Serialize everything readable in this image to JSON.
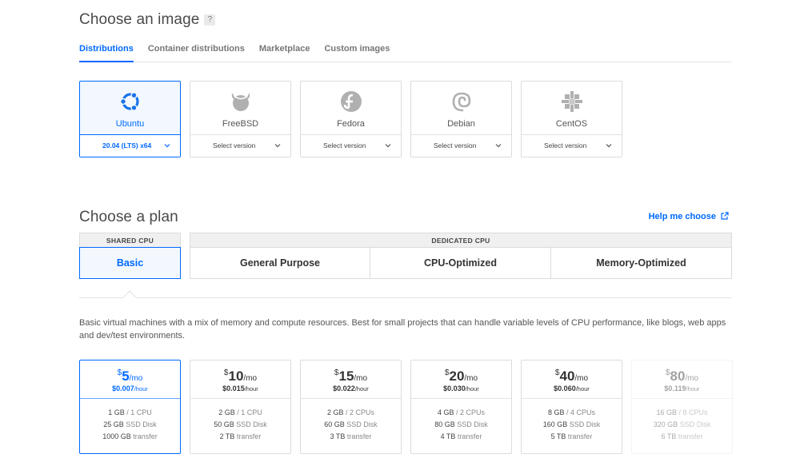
{
  "image_section": {
    "title": "Choose an image",
    "help": "?",
    "tabs": [
      {
        "label": "Distributions",
        "active": true
      },
      {
        "label": "Container distributions",
        "active": false
      },
      {
        "label": "Marketplace",
        "active": false
      },
      {
        "label": "Custom images",
        "active": false
      }
    ],
    "distros": [
      {
        "name": "Ubuntu",
        "version": "20.04 (LTS) x64",
        "icon": "ubuntu-icon",
        "selected": true
      },
      {
        "name": "FreeBSD",
        "version": "Select version",
        "icon": "freebsd-icon",
        "selected": false
      },
      {
        "name": "Fedora",
        "version": "Select version",
        "icon": "fedora-icon",
        "selected": false
      },
      {
        "name": "Debian",
        "version": "Select version",
        "icon": "debian-icon",
        "selected": false
      },
      {
        "name": "CentOS",
        "version": "Select version",
        "icon": "centos-icon",
        "selected": false
      }
    ]
  },
  "plan_section": {
    "title": "Choose a plan",
    "help_link": "Help me choose",
    "shared_label": "SHARED CPU",
    "dedicated_label": "DEDICATED CPU",
    "plans": {
      "basic": "Basic",
      "general": "General Purpose",
      "cpu": "CPU-Optimized",
      "memory": "Memory-Optimized"
    },
    "description": "Basic virtual machines with a mix of memory and compute resources. Best for small projects that can handle variable levels of CPU performance, like blogs, web apps and dev/test environments.",
    "prices": [
      {
        "dollar": "$",
        "price": "5",
        "per": "/mo",
        "hourly": "$0.007",
        "hour_unit": "/hour",
        "mem_amt": "1 GB",
        "cpu": "/ 1 CPU",
        "disk_amt": "25 GB",
        "disk_unit": "SSD Disk",
        "transfer_amt": "1000 GB",
        "transfer_unit": "transfer",
        "selected": true,
        "disabled": false
      },
      {
        "dollar": "$",
        "price": "10",
        "per": "/mo",
        "hourly": "$0.015",
        "hour_unit": "/hour",
        "mem_amt": "2 GB",
        "cpu": "/ 1 CPU",
        "disk_amt": "50 GB",
        "disk_unit": "SSD Disk",
        "transfer_amt": "2 TB",
        "transfer_unit": "transfer",
        "selected": false,
        "disabled": false
      },
      {
        "dollar": "$",
        "price": "15",
        "per": "/mo",
        "hourly": "$0.022",
        "hour_unit": "/hour",
        "mem_amt": "2 GB",
        "cpu": "/ 2 CPUs",
        "disk_amt": "60 GB",
        "disk_unit": "SSD Disk",
        "transfer_amt": "3 TB",
        "transfer_unit": "transfer",
        "selected": false,
        "disabled": false
      },
      {
        "dollar": "$",
        "price": "20",
        "per": "/mo",
        "hourly": "$0.030",
        "hour_unit": "/hour",
        "mem_amt": "4 GB",
        "cpu": "/ 2 CPUs",
        "disk_amt": "80 GB",
        "disk_unit": "SSD Disk",
        "transfer_amt": "4 TB",
        "transfer_unit": "transfer",
        "selected": false,
        "disabled": false
      },
      {
        "dollar": "$",
        "price": "40",
        "per": "/mo",
        "hourly": "$0.060",
        "hour_unit": "/hour",
        "mem_amt": "8 GB",
        "cpu": "/ 4 CPUs",
        "disk_amt": "160 GB",
        "disk_unit": "SSD Disk",
        "transfer_amt": "5 TB",
        "transfer_unit": "transfer",
        "selected": false,
        "disabled": false
      },
      {
        "dollar": "$",
        "price": "80",
        "per": "/mo",
        "hourly": "$0.119",
        "hour_unit": "/hour",
        "mem_amt": "16 GB",
        "cpu": "/ 8 CPUs",
        "disk_amt": "320 GB",
        "disk_unit": "SSD Disk",
        "transfer_amt": "6 TB",
        "transfer_unit": "transfer",
        "selected": false,
        "disabled": true
      }
    ]
  },
  "colors": {
    "accent": "#0069ff",
    "border": "#dcdcdc",
    "header_bg": "#f0f0f0"
  }
}
